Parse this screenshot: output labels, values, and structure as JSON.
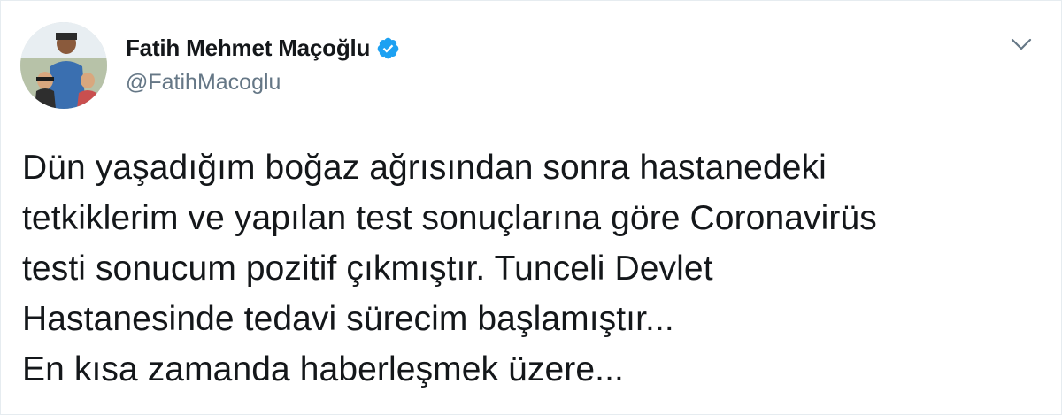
{
  "author": {
    "display_name": "Fatih Mehmet Maçoğlu",
    "handle": "@FatihMacoglu",
    "verified": true,
    "avatar_icon": "profile-photo"
  },
  "tweet": {
    "lines": [
      "Dün yaşadığım boğaz ağrısından sonra hastanedeki",
      "tetkiklerim ve yapılan test sonuçlarına göre Coronavirüs",
      "testi sonucum pozitif çıkmıştır. Tunceli Devlet",
      "Hastanesinde tedavi sürecim başlamıştır...",
      "En kısa zamanda haberleşmek üzere..."
    ]
  },
  "icons": {
    "verified": "verified-badge-icon",
    "menu": "chevron-down-icon"
  },
  "colors": {
    "verified_blue": "#1da1f2",
    "text_primary": "#14171a",
    "text_secondary": "#657786"
  }
}
